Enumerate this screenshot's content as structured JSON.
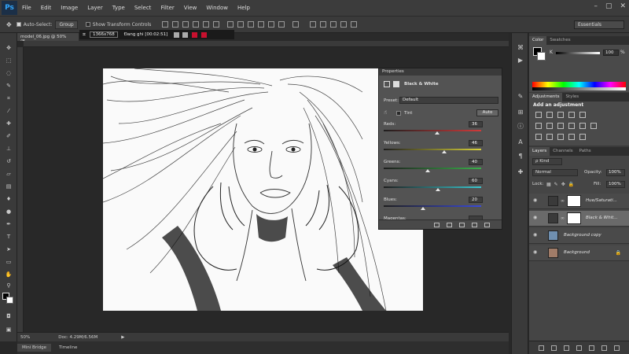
{
  "app": {
    "logo": "Ps"
  },
  "menu": [
    "File",
    "Edit",
    "Image",
    "Layer",
    "Type",
    "Select",
    "Filter",
    "View",
    "Window",
    "Help"
  ],
  "window_controls": [
    "–",
    "▢",
    "✕"
  ],
  "options_bar": {
    "auto_select_label": "Auto-Select:",
    "auto_select_value": "Group",
    "show_transform_label": "Show Transform Controls",
    "workspace": "Essentials"
  },
  "document": {
    "tab_title": "model_06.jpg @ 50% (B...",
    "zoom": "50%",
    "doc_size": "Doc: 4.29M/6.56M"
  },
  "recorder": {
    "resolution": "1366x768",
    "status": "Đang ghi [00:02:51]"
  },
  "bottom_tabs": [
    "Mini Bridge",
    "Timeline"
  ],
  "properties": {
    "tab": "Properties",
    "type": "Black & White",
    "preset_label": "Preset:",
    "preset_value": "Default",
    "tint_label": "Tint",
    "auto_label": "Auto",
    "sliders": [
      {
        "label": "Reds:",
        "value": "36",
        "fraction": 0.55,
        "color": "#d23a3a"
      },
      {
        "label": "Yellows:",
        "value": "46",
        "fraction": 0.62,
        "color": "#d9d23a"
      },
      {
        "label": "Greens:",
        "value": "40",
        "fraction": 0.45,
        "color": "#3ab04a"
      },
      {
        "label": "Cyans:",
        "value": "60",
        "fraction": 0.56,
        "color": "#3ac8d0"
      },
      {
        "label": "Blues:",
        "value": "20",
        "fraction": 0.4,
        "color": "#3a4ad8"
      },
      {
        "label": "Magentas:",
        "value": "",
        "fraction": 0.5,
        "color": "#c83ab8"
      }
    ]
  },
  "panels": {
    "color_tabs": [
      "Color",
      "Swatches"
    ],
    "color_channel": "K",
    "color_value": "100",
    "color_unit": "%",
    "adjust_tabs": [
      "Adjustments",
      "Styles"
    ],
    "adjust_title": "Add an adjustment",
    "layer_tabs": [
      "Layers",
      "Channels",
      "Paths"
    ],
    "kind_label": "ρ Kind",
    "blend_mode": "Normal",
    "opacity_label": "Opacity:",
    "opacity_value": "100%",
    "lock_label": "Lock:",
    "fill_label": "Fill:",
    "fill_value": "100%"
  },
  "layers": [
    {
      "name": "Hue/Saturati...",
      "kind": "adjustment",
      "selected": false
    },
    {
      "name": "Black & Whit...",
      "kind": "adjustment",
      "selected": true
    },
    {
      "name": "Background copy",
      "kind": "image",
      "selected": false
    },
    {
      "name": "Background",
      "kind": "image",
      "selected": false,
      "locked": true
    }
  ],
  "colors": {
    "accent_blue": "#31a8ff",
    "record_red": "#c8102e",
    "selected_layer": "#6a6a6a"
  }
}
